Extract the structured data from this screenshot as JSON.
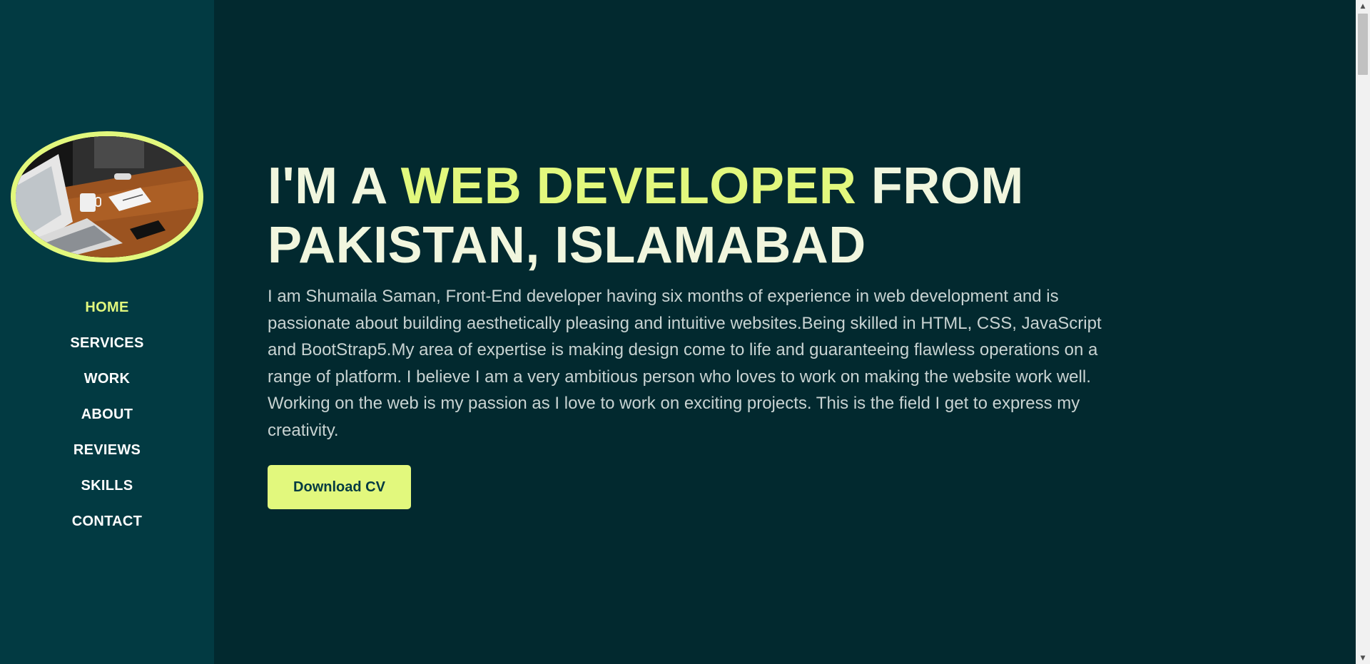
{
  "sidebar": {
    "avatar_alt": "laptop-on-desk-photo",
    "nav": [
      {
        "label": "HOME",
        "active": true
      },
      {
        "label": "SERVICES",
        "active": false
      },
      {
        "label": "WORK",
        "active": false
      },
      {
        "label": "ABOUT",
        "active": false
      },
      {
        "label": "REVIEWS",
        "active": false
      },
      {
        "label": "SKILLS",
        "active": false
      },
      {
        "label": "CONTACT",
        "active": false
      }
    ]
  },
  "hero": {
    "headline_prefix": "I'M A",
    "headline_accent": "WEB DEVELOPER",
    "headline_suffix": "FROM PAKISTAN, ISLAMABAD",
    "intro": "I am Shumaila Saman, Front-End developer having six months of experience in web development and is passionate about building aesthetically pleasing and intuitive websites.Being skilled in HTML, CSS, JavaScript and BootStrap5.My area of expertise is making design come to life and guaranteeing flawless operations on a range of platform. I believe I am a very ambitious person who loves to work on making the website work well. Working on the web is my passion as I love to work on exciting projects. This is the field I get to express my creativity.",
    "cv_button": "Download CV"
  },
  "theme": {
    "sidebar_bg": "#023a42",
    "main_bg": "#02292f",
    "accent": "#e2f87d",
    "headline_text": "#f1f6de",
    "body_text": "#c8d3d2"
  },
  "icons": {
    "scroll_up": "▲",
    "scroll_down": "▼"
  }
}
